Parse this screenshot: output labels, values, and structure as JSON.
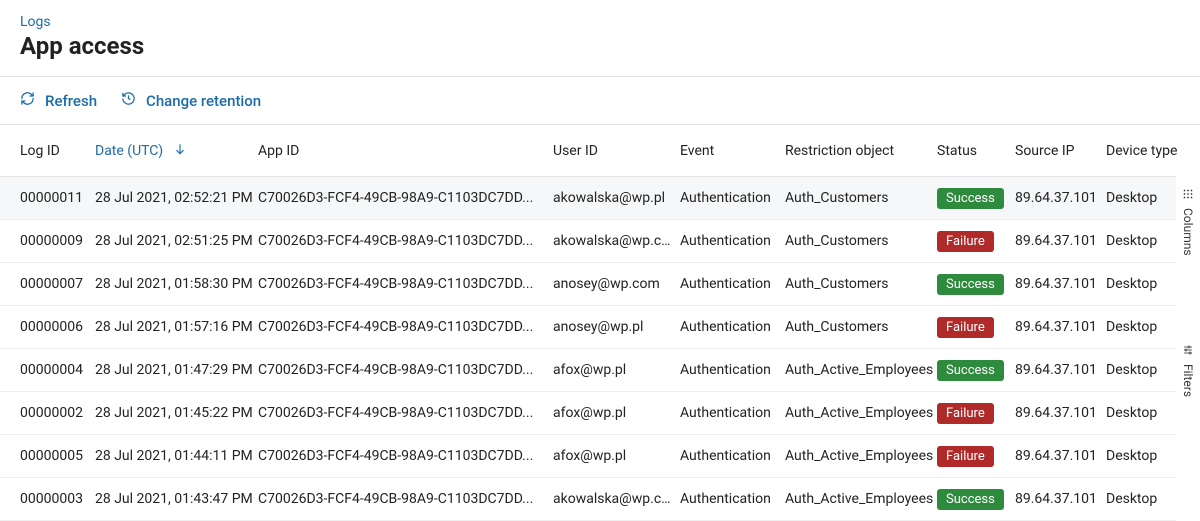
{
  "breadcrumb": "Logs",
  "title": "App access",
  "toolbar": {
    "refresh": "Refresh",
    "change_retention": "Change retention"
  },
  "columns": {
    "logid": "Log ID",
    "date": "Date (UTC)",
    "appid": "App ID",
    "user": "User ID",
    "event": "Event",
    "restriction": "Restriction object",
    "status": "Status",
    "ip": "Source IP",
    "device": "Device type"
  },
  "side": {
    "columns": "Columns",
    "filters": "Filters"
  },
  "status_labels": {
    "success": "Success",
    "failure": "Failure"
  },
  "rows": [
    {
      "logid": "00000011",
      "date": "28 Jul 2021, 02:52:21 PM",
      "appid": "C70026D3-FCF4-49CB-98A9-C1103DC7DD...",
      "user": "akowalska@wp.pl",
      "event": "Authentication",
      "restriction": "Auth_Customers",
      "status": "success",
      "ip": "89.64.37.101",
      "device": "Desktop"
    },
    {
      "logid": "00000009",
      "date": "28 Jul 2021, 02:51:25 PM",
      "appid": "C70026D3-FCF4-49CB-98A9-C1103DC7DD...",
      "user": "akowalska@wp.com",
      "event": "Authentication",
      "restriction": "Auth_Customers",
      "status": "failure",
      "ip": "89.64.37.101",
      "device": "Desktop"
    },
    {
      "logid": "00000007",
      "date": "28 Jul 2021, 01:58:30 PM",
      "appid": "C70026D3-FCF4-49CB-98A9-C1103DC7DD...",
      "user": "anosey@wp.com",
      "event": "Authentication",
      "restriction": "Auth_Customers",
      "status": "success",
      "ip": "89.64.37.101",
      "device": "Desktop"
    },
    {
      "logid": "00000006",
      "date": "28 Jul 2021, 01:57:16 PM",
      "appid": "C70026D3-FCF4-49CB-98A9-C1103DC7DD...",
      "user": "anosey@wp.pl",
      "event": "Authentication",
      "restriction": "Auth_Customers",
      "status": "failure",
      "ip": "89.64.37.101",
      "device": "Desktop"
    },
    {
      "logid": "00000004",
      "date": "28 Jul 2021, 01:47:29 PM",
      "appid": "C70026D3-FCF4-49CB-98A9-C1103DC7DD...",
      "user": "afox@wp.pl",
      "event": "Authentication",
      "restriction": "Auth_Active_Employees",
      "status": "success",
      "ip": "89.64.37.101",
      "device": "Desktop"
    },
    {
      "logid": "00000002",
      "date": "28 Jul 2021, 01:45:22 PM",
      "appid": "C70026D3-FCF4-49CB-98A9-C1103DC7DD...",
      "user": "afox@wp.pl",
      "event": "Authentication",
      "restriction": "Auth_Active_Employees",
      "status": "failure",
      "ip": "89.64.37.101",
      "device": "Desktop"
    },
    {
      "logid": "00000005",
      "date": "28 Jul 2021, 01:44:11 PM",
      "appid": "C70026D3-FCF4-49CB-98A9-C1103DC7DD...",
      "user": "afox@wp.pl",
      "event": "Authentication",
      "restriction": "Auth_Active_Employees",
      "status": "failure",
      "ip": "89.64.37.101",
      "device": "Desktop"
    },
    {
      "logid": "00000003",
      "date": "28 Jul 2021, 01:43:47 PM",
      "appid": "C70026D3-FCF4-49CB-98A9-C1103DC7DD...",
      "user": "akowalska@wp.com",
      "event": "Authentication",
      "restriction": "Auth_Active_Employees",
      "status": "success",
      "ip": "89.64.37.101",
      "device": "Desktop"
    }
  ]
}
